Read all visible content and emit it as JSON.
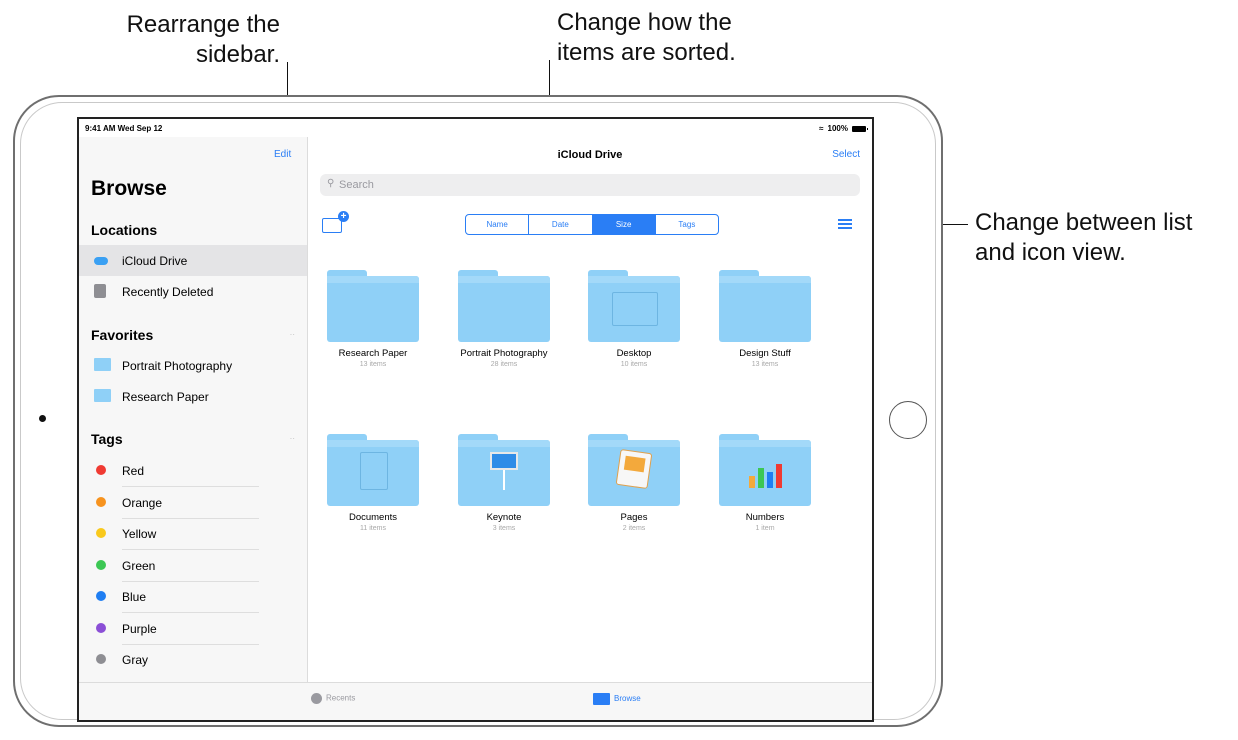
{
  "callouts": {
    "sidebar_line1": "Rearrange the",
    "sidebar_line2": "sidebar.",
    "sort_line1": "Change how the",
    "sort_line2": "items are sorted.",
    "view_line1": "Change between list",
    "view_line2": "and icon view."
  },
  "status": {
    "time": "9:41 AM  Wed Sep 12",
    "battery": "100%"
  },
  "sidebar": {
    "edit": "Edit",
    "title": "Browse",
    "locations_title": "Locations",
    "locations": [
      {
        "label": "iCloud Drive",
        "icon": "cloud-icon",
        "selected": true
      },
      {
        "label": "Recently Deleted",
        "icon": "trash-icon",
        "selected": false
      }
    ],
    "favorites_title": "Favorites",
    "favorites": [
      {
        "label": "Portrait Photography",
        "icon": "folder-icon"
      },
      {
        "label": "Research Paper",
        "icon": "folder-icon"
      }
    ],
    "tags_title": "Tags",
    "tags": [
      {
        "label": "Red",
        "color": "#f03a32"
      },
      {
        "label": "Orange",
        "color": "#f7931e"
      },
      {
        "label": "Yellow",
        "color": "#f9c91c"
      },
      {
        "label": "Green",
        "color": "#3cc754"
      },
      {
        "label": "Blue",
        "color": "#1f7ef2"
      },
      {
        "label": "Purple",
        "color": "#8b4fd6"
      },
      {
        "label": "Gray",
        "color": "#8e8e93"
      }
    ]
  },
  "main": {
    "title": "iCloud Drive",
    "select": "Select",
    "search_placeholder": "Search",
    "sort_options": [
      "Name",
      "Date",
      "Size",
      "Tags"
    ],
    "active_sort": "Size",
    "files": [
      {
        "name": "Research Paper",
        "count": "13 items",
        "glyph": "none"
      },
      {
        "name": "Portrait Photography",
        "count": "28 items",
        "glyph": "none"
      },
      {
        "name": "Desktop",
        "count": "10 items",
        "glyph": "window"
      },
      {
        "name": "Design Stuff",
        "count": "13 items",
        "glyph": "none"
      },
      {
        "name": "Documents",
        "count": "11 items",
        "glyph": "document"
      },
      {
        "name": "Keynote",
        "count": "3 items",
        "glyph": "keynote"
      },
      {
        "name": "Pages",
        "count": "2 items",
        "glyph": "pages"
      },
      {
        "name": "Numbers",
        "count": "1 item",
        "glyph": "numbers"
      }
    ]
  },
  "tabbar": {
    "recents": "Recents",
    "browse": "Browse"
  },
  "colors": {
    "accent": "#2a7ef5",
    "folder": "#8fd0f7"
  }
}
